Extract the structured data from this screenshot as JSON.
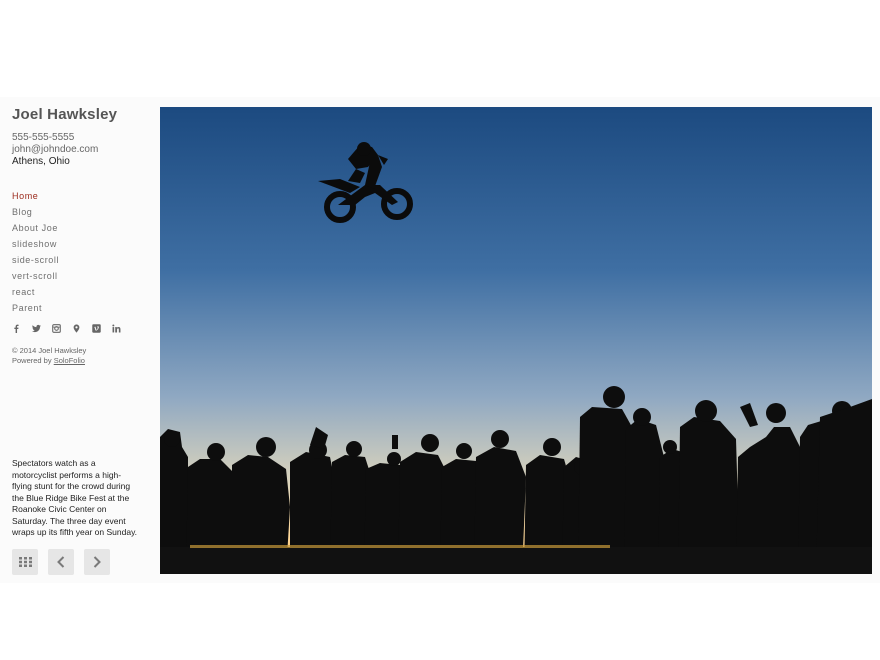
{
  "site": {
    "title": "Joel Hawksley",
    "phone": "555-555-5555",
    "email": "john@johndoe.com",
    "location": "Athens, Ohio"
  },
  "nav": {
    "items": [
      {
        "label": "Home",
        "active": true
      },
      {
        "label": "Blog",
        "active": false
      },
      {
        "label": "About Joe",
        "active": false
      },
      {
        "label": "slideshow",
        "active": false
      },
      {
        "label": "side-scroll",
        "active": false
      },
      {
        "label": "vert-scroll",
        "active": false
      },
      {
        "label": "react",
        "active": false
      },
      {
        "label": "Parent",
        "active": false
      }
    ]
  },
  "social": [
    "facebook-icon",
    "twitter-icon",
    "instagram-icon",
    "map-pin-icon",
    "vimeo-icon",
    "linkedin-icon"
  ],
  "footer": {
    "copyright": "© 2014 Joel Hawksley",
    "powered_prefix": "Powered by",
    "powered_link": "SoloFolio"
  },
  "photo": {
    "caption": "Spectators watch as a motorcyclist performs a high-flying stunt for the crowd during the Blue Ridge Bike Fest at the Roanoke Civic Center on Saturday. The three day event wraps up its fifth year on Sunday."
  },
  "controls": [
    "grid-icon",
    "prev-arrow-icon",
    "next-arrow-icon"
  ],
  "colors": {
    "accent": "#9b2a1c",
    "sky_top": "#1d4f86",
    "sky_bottom": "#ffdca0"
  }
}
